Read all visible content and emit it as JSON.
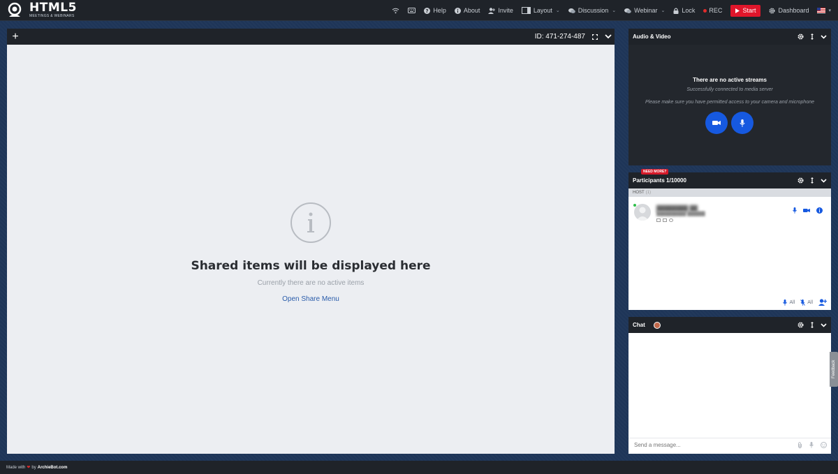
{
  "brand": {
    "title": "HTML5",
    "subtitle": "MEETINGS & WEBINARS"
  },
  "topbar": {
    "help": "Help",
    "about": "About",
    "invite": "Invite",
    "layout": "Layout",
    "discussion": "Discussion",
    "webinar": "Webinar",
    "lock": "Lock",
    "rec": "REC",
    "start": "Start",
    "dashboard": "Dashboard"
  },
  "stage": {
    "add": "+",
    "room_id": "ID: 471-274-487",
    "empty_title": "Shared items will be displayed here",
    "empty_subtitle": "Currently there are no active items",
    "open_share": "Open Share Menu"
  },
  "av": {
    "title": "Audio & Video",
    "no_streams": "There are no active streams",
    "connected": "Successfully connected to media server",
    "permission": "Please make sure you have permitted access to your camera and microphone"
  },
  "participants": {
    "badge": "NEED MORE?",
    "title": "Participants 1/10000",
    "host_label": "HOST",
    "host_count": "(1)",
    "mute_all": "All",
    "unmute_all": "All"
  },
  "chat": {
    "title": "Chat",
    "placeholder": "Send a message..."
  },
  "feedback": "Feedback",
  "footer": {
    "made_with": "Made with",
    "by": "by",
    "company": "ArchieBot.com"
  },
  "colors": {
    "accent_blue": "#1659e0",
    "rec_red": "#e0162b",
    "dark_bg": "#1f2329",
    "page_bg": "#1e3558"
  }
}
